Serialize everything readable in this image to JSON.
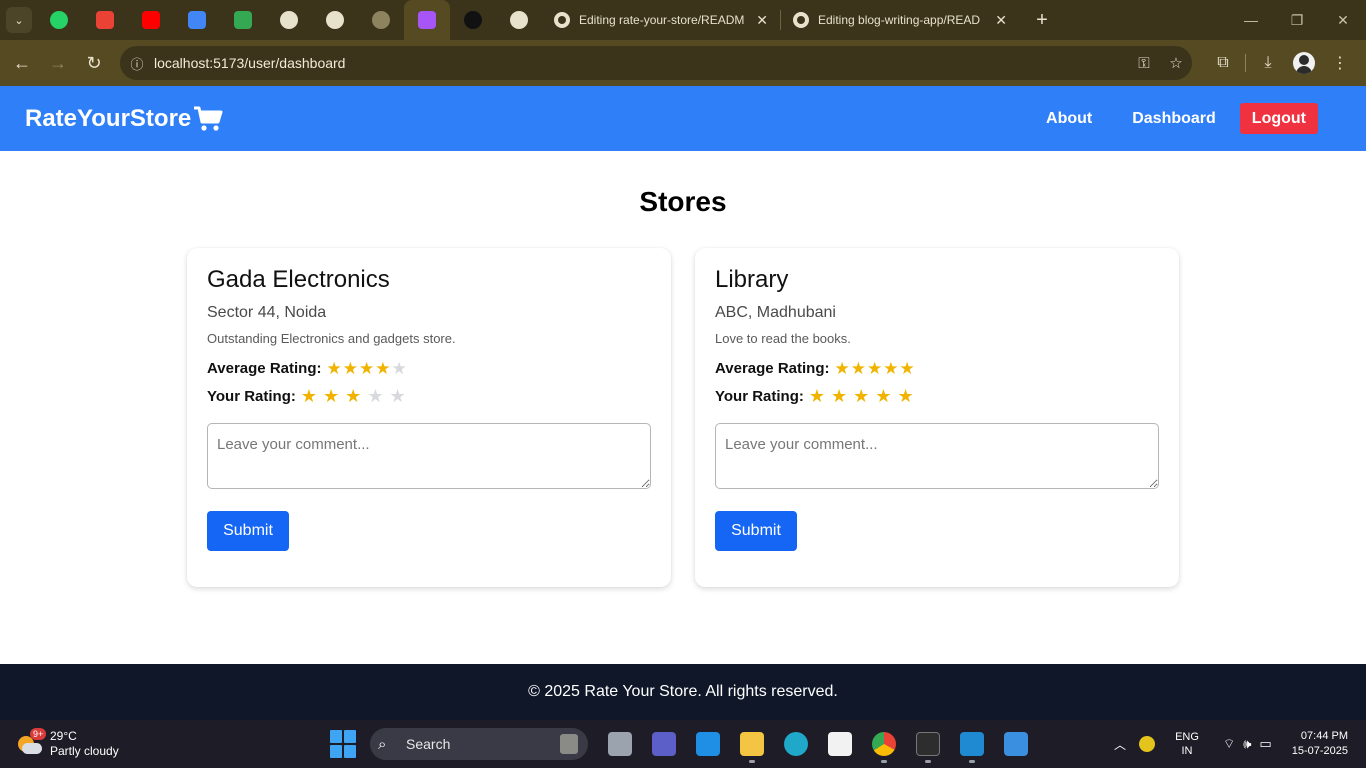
{
  "browser": {
    "pinned_tabs": [
      {
        "name": "whatsapp",
        "color": "#25d366"
      },
      {
        "name": "gmail",
        "color": "#ea4335"
      },
      {
        "name": "youtube",
        "color": "#ff0000"
      },
      {
        "name": "google-docs",
        "color": "#4285f4"
      },
      {
        "name": "google-sheets",
        "color": "#34a853"
      },
      {
        "name": "chatgpt",
        "color": "#e8e2cc"
      },
      {
        "name": "chatgpt-2",
        "color": "#e8e2cc"
      },
      {
        "name": "globe",
        "color": "#8d845f"
      },
      {
        "name": "vite",
        "color": "#a855f7"
      },
      {
        "name": "app",
        "color": "#111111"
      },
      {
        "name": "github",
        "color": "#e8e2cc"
      }
    ],
    "tabs": [
      {
        "title": "Editing rate-your-store/READM",
        "close": "✕"
      },
      {
        "title": "Editing blog-writing-app/READ",
        "close": "✕"
      }
    ],
    "new_tab": "+",
    "url": "localhost:5173/user/dashboard",
    "window_controls": {
      "minimize": "—",
      "restore": "❐",
      "close": "✕"
    }
  },
  "nav": {
    "brand": "RateYourStore",
    "links": [
      "About",
      "Dashboard"
    ],
    "logout": "Logout",
    "accent_color": "#2f7ff8",
    "logout_color": "#f0313f"
  },
  "page": {
    "title": "Stores"
  },
  "stores": [
    {
      "name": "Gada Electronics",
      "address": "Sector 44, Noida",
      "description": "Outstanding Electronics and gadgets store.",
      "avg_label": "Average Rating:",
      "avg_rating": 4,
      "your_label": "Your Rating:",
      "your_rating": 3,
      "comment_placeholder": "Leave your comment...",
      "submit": "Submit"
    },
    {
      "name": "Library",
      "address": "ABC, Madhubani",
      "description": "Love to read the books.",
      "avg_label": "Average Rating:",
      "avg_rating": 5,
      "your_label": "Your Rating:",
      "your_rating": 5,
      "comment_placeholder": "Leave your comment...",
      "submit": "Submit"
    }
  ],
  "footer": {
    "text": "© 2025 Rate Your Store. All rights reserved."
  },
  "taskbar": {
    "weather_badge": "9+",
    "temperature": "29°C",
    "condition": "Partly cloudy",
    "search_placeholder": "Search",
    "lang_line1": "ENG",
    "lang_line2": "IN",
    "time": "07:44 PM",
    "date": "15-07-2025"
  }
}
